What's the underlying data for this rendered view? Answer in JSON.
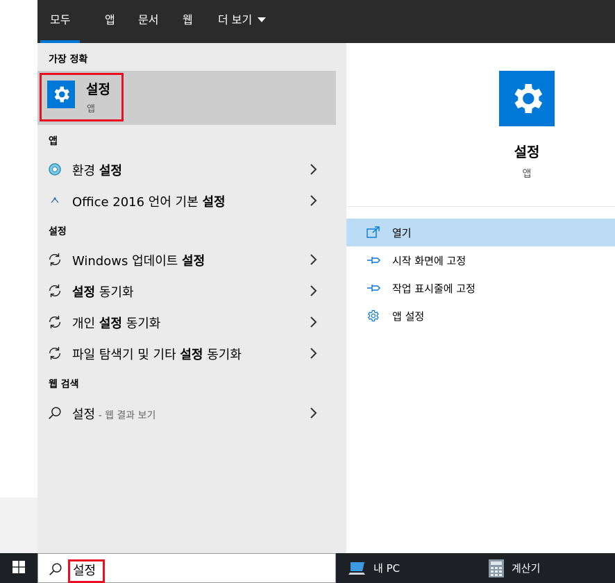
{
  "tabs": [
    {
      "label": "모두",
      "active": true
    },
    {
      "label": "앱"
    },
    {
      "label": "문서"
    },
    {
      "label": "웹"
    },
    {
      "label": "더 보기"
    }
  ],
  "best_match": {
    "section_label": "가장 정확",
    "title": "설정",
    "subtitle": "앱",
    "icon": "gear-icon"
  },
  "apps_section": {
    "label": "앱",
    "items": [
      {
        "pre": "환경 ",
        "bold": "설정",
        "post": "",
        "icon": "control-panel-icon"
      },
      {
        "pre": "Office 2016 언어 기본 ",
        "bold": "설정",
        "post": "",
        "icon": "office-language-icon"
      }
    ]
  },
  "settings_section": {
    "label": "설정",
    "items": [
      {
        "pre": "Windows 업데이트 ",
        "bold": "설정",
        "post": "",
        "icon": "sync-icon"
      },
      {
        "pre": "",
        "bold": "설정",
        "post": " 동기화",
        "icon": "sync-icon"
      },
      {
        "pre": "개인 ",
        "bold": "설정",
        "post": " 동기화",
        "icon": "sync-icon"
      },
      {
        "pre": "파일 탐색기 및 기타 ",
        "bold": "설정",
        "post": " 동기화",
        "icon": "sync-icon"
      }
    ]
  },
  "web_section": {
    "label": "웹 검색",
    "item": {
      "text": "설정",
      "suffix": " - 웹 결과 보기",
      "icon": "search-icon"
    }
  },
  "preview": {
    "title": "설정",
    "subtitle": "앱",
    "actions": [
      {
        "label": "열기",
        "icon": "open-icon",
        "hover": true
      },
      {
        "label": "시작 화면에 고정",
        "icon": "pin-icon"
      },
      {
        "label": "작업 표시줄에 고정",
        "icon": "pin-icon"
      },
      {
        "label": "앱 설정",
        "icon": "gear-icon"
      }
    ]
  },
  "taskbar": {
    "search_value": "설정",
    "items": [
      {
        "label": "내 PC",
        "icon": "pc-icon"
      },
      {
        "label": "계산기",
        "icon": "calculator-icon"
      }
    ]
  },
  "colors": {
    "accent": "#0078d7",
    "highlight_border": "#e81123",
    "hover": "#bcdcf5",
    "topbar": "#2b2b2b"
  }
}
